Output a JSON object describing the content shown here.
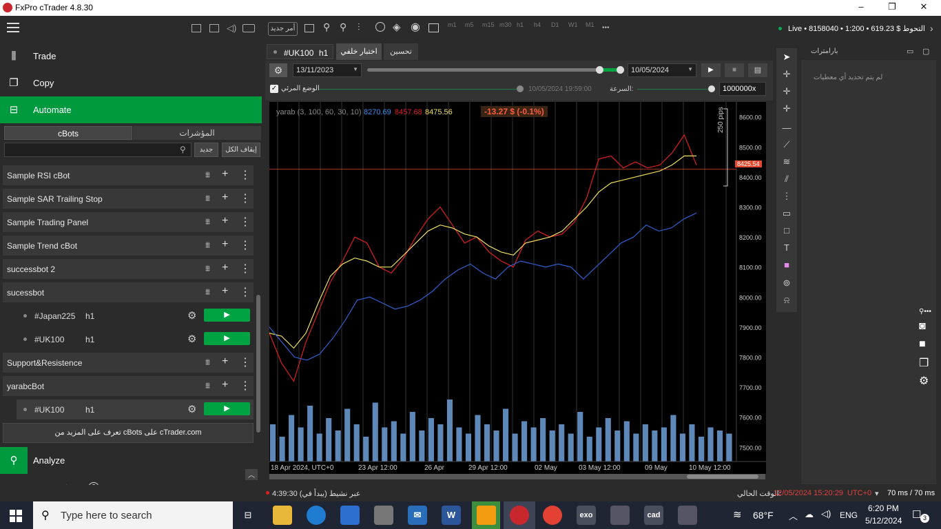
{
  "window": {
    "title": "FxPro cTrader 4.8.30",
    "min": "–",
    "max": "❐",
    "close": "✕"
  },
  "header": {
    "new_order": "أمر جديد",
    "timeframes": [
      "m1",
      "m5",
      "m15",
      "m30",
      "h1",
      "h4",
      "D1",
      "W1",
      "M1"
    ],
    "more": "•••",
    "account": "Live • 8158040 • 1:200 • 619.23 $ التحوط",
    "chevron": "›"
  },
  "nav": {
    "trade": "Trade",
    "copy": "Copy",
    "automate": "Automate",
    "analyze": "Analyze"
  },
  "automate": {
    "tab_cbots": "cBots",
    "tab_indicators": "المؤشرات",
    "new_btn": "جديد",
    "stop_all_btn": "إيقاف الكل",
    "bots": [
      {
        "name": "Sample RSI cBot"
      },
      {
        "name": "Sample SAR Trailing Stop"
      },
      {
        "name": "Sample Trading Panel"
      },
      {
        "name": "Sample Trend cBot"
      },
      {
        "name": "successbot 2"
      },
      {
        "name": "sucessbot"
      },
      {
        "name": "Support&Resistence"
      },
      {
        "name": "yarabcBot"
      }
    ],
    "instances": [
      {
        "symbol": "#Japan225",
        "tf": "h1"
      },
      {
        "symbol": "#UK100",
        "tf": "h1"
      },
      {
        "symbol": "#UK100",
        "tf": "h1"
      }
    ],
    "learn_more": "تعرف على المزيد من cBots على cTrader.com"
  },
  "chart_tabs": {
    "symbol_tab": "#UK100",
    "tf_tab": "h1",
    "backtest": "اختبار خلفي",
    "optimize": "تحسين"
  },
  "backtest": {
    "start_date": "13/11/2023",
    "end_date": "10/05/2024",
    "visual_mode": "الوضع المرئي",
    "current_time": "10/05/2024 19:59:00",
    "speed_label": "السرعة:",
    "speed_value": "1000000x",
    "progress": 1.0
  },
  "legend": {
    "name": "yarab (3, 100, 60, 30, 10)",
    "v1": "8270.69",
    "v2": "8457.68",
    "v3": "8475.56",
    "pnl": "-13.27 $ (-0.1%)",
    "pips": "250 pips",
    "price_tag": "8425.54"
  },
  "chart_data": {
    "type": "line",
    "y_ticks": [
      "8600.00",
      "8500.00",
      "8400.00",
      "8300.00",
      "8200.00",
      "8100.00",
      "8000.00",
      "7900.00",
      "7800.00",
      "7700.00",
      "7600.00",
      "7500.00"
    ],
    "x_ticks": [
      "18 Apr 2024, UTC+0",
      "23 Apr 12:00",
      "26 Apr",
      "29 Apr 12:00",
      "02 May",
      "03 May 12:00",
      "09 May",
      "10 May 12:00"
    ],
    "ylim": [
      7480,
      8620
    ],
    "current_price": 8425.54,
    "series": [
      {
        "color": "#e02020",
        "values": [
          7880,
          7780,
          7720,
          7850,
          7950,
          8050,
          8120,
          8200,
          8180,
          8100,
          8080,
          8130,
          8200,
          8260,
          8300,
          8240,
          8180,
          8200,
          8150,
          8120,
          8100,
          8190,
          8220,
          8200,
          8210,
          8250,
          8330,
          8460,
          8470,
          8430,
          8450,
          8430,
          8440,
          8480,
          8540,
          8440
        ]
      },
      {
        "color": "#f0e060",
        "values": [
          7880,
          7870,
          7830,
          7880,
          7980,
          8070,
          8110,
          8130,
          8120,
          8100,
          8100,
          8140,
          8180,
          8220,
          8240,
          8230,
          8210,
          8200,
          8170,
          8150,
          8140,
          8180,
          8190,
          8200,
          8220,
          8260,
          8300,
          8350,
          8380,
          8390,
          8400,
          8410,
          8420,
          8440,
          8470,
          8470
        ]
      },
      {
        "color": "#3060d0",
        "values": [
          7900,
          7850,
          7800,
          7790,
          7810,
          7860,
          7920,
          7990,
          8000,
          7980,
          7960,
          7970,
          7990,
          8020,
          8060,
          8090,
          8110,
          8080,
          8060,
          8100,
          8120,
          8110,
          8100,
          8110,
          8100,
          8060,
          8100,
          8140,
          8180,
          8200,
          8240,
          8220,
          8230,
          8260,
          8280
        ]
      }
    ],
    "volume": [
      60,
      40,
      75,
      55,
      90,
      45,
      70,
      50,
      85,
      60,
      40,
      95,
      55,
      65,
      45,
      80,
      50,
      70,
      60,
      100,
      55,
      45,
      75,
      60,
      50,
      85,
      45,
      65,
      55,
      70,
      50,
      60,
      45,
      80,
      40,
      55,
      70,
      50,
      65,
      45,
      60,
      50,
      55,
      75,
      45,
      60,
      40,
      55,
      50,
      45
    ]
  },
  "right_panel": {
    "title": "بارامترات",
    "empty": "لم يتم تحديد أي معطيات"
  },
  "status": {
    "left": "4:39:30 (عبر نشيط (يبدأ في",
    "current_time_label": "الوقت الحالي:",
    "server_time": "12/05/2024 15:20:29",
    "tz": "UTC+0",
    "latency": "70 ms / 70 ms"
  },
  "taskbar": {
    "search_placeholder": "Type here to search",
    "weather": "68°F",
    "lang": "ENG",
    "time": "6:20 PM",
    "date": "5/12/2024",
    "notif": "3"
  }
}
